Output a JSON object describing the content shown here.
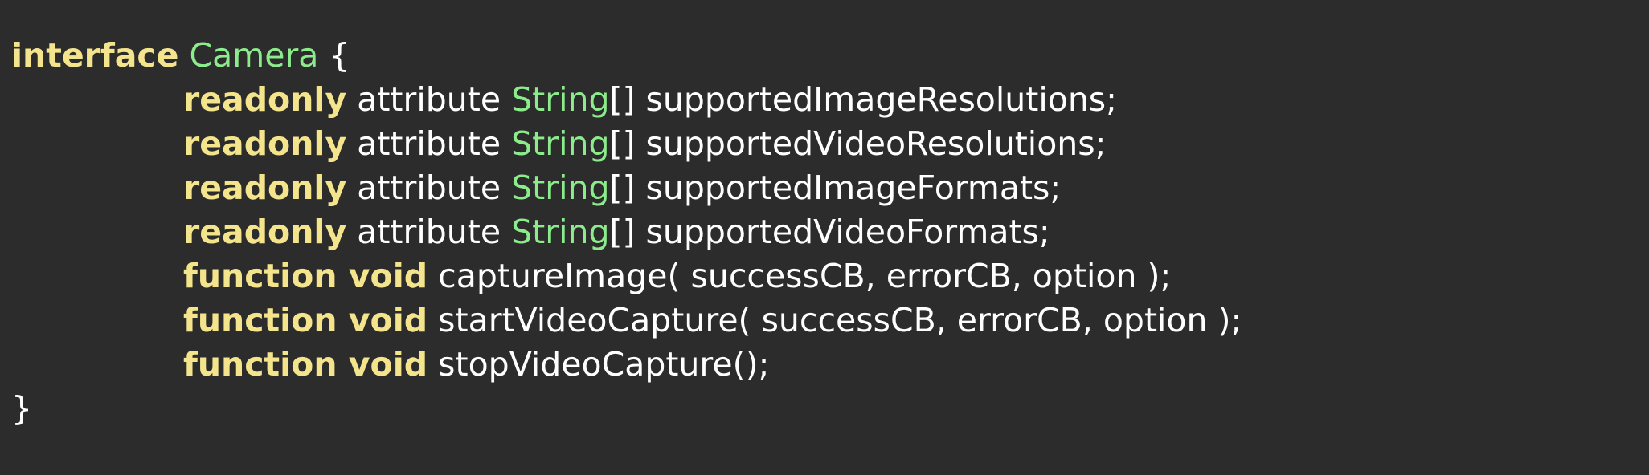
{
  "colors": {
    "background": "#2c2c2c",
    "keyword": "#f4e58c",
    "type": "#8cec8c",
    "text": "#ffffff"
  },
  "code": {
    "line1": {
      "keyword": "interface",
      "name": "Camera",
      "brace": "{"
    },
    "line2": {
      "keyword": "readonly",
      "text": "attribute",
      "type": "String",
      "rest": "[] supportedImageResolutions;"
    },
    "line3": {
      "keyword": "readonly",
      "text": "attribute",
      "type": "String",
      "rest": "[] supportedVideoResolutions;"
    },
    "line4": {
      "keyword": "readonly",
      "text": "attribute",
      "type": "String",
      "rest": "[] supportedImageFormats;"
    },
    "line5": {
      "keyword": "readonly",
      "text": "attribute",
      "type": "String",
      "rest": "[] supportedVideoFormats;"
    },
    "line6": {
      "keyword": "function void",
      "rest": "captureImage( successCB, errorCB, option );"
    },
    "line7": {
      "keyword": "function void",
      "rest": "startVideoCapture( successCB, errorCB, option );"
    },
    "line8": {
      "keyword": "function void",
      "rest": "stopVideoCapture();"
    },
    "line9": {
      "brace": "}"
    }
  }
}
